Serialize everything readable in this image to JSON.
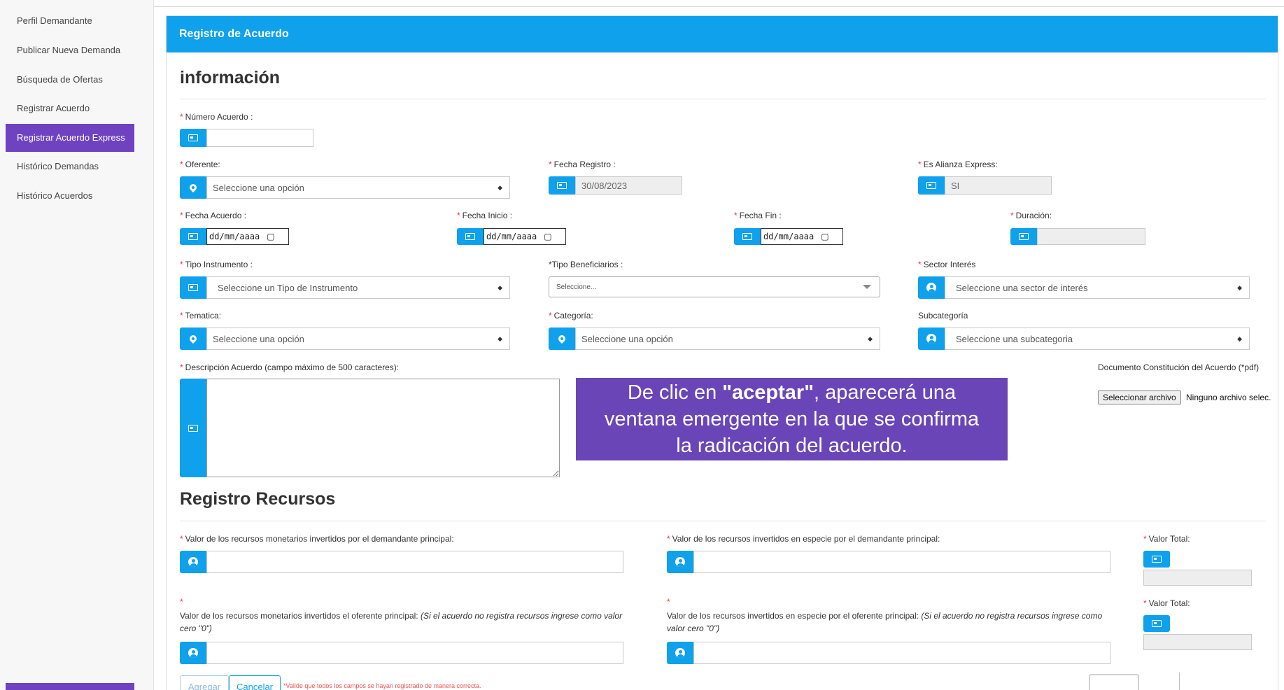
{
  "sidebar": {
    "items": [
      {
        "label": "Perfil Demandante"
      },
      {
        "label": "Publicar Nueva Demanda"
      },
      {
        "label": "Búsqueda de Ofertas"
      },
      {
        "label": "Registrar Acuerdo"
      },
      {
        "label": "Registrar Acuerdo Express",
        "active": true
      },
      {
        "label": "Histórico Demandas"
      },
      {
        "label": "Histórico Acuerdos"
      }
    ]
  },
  "panel": {
    "title": "Registro de Acuerdo",
    "section_info": "información",
    "section_resources": "Registro Recursos"
  },
  "form": {
    "numero_acuerdo": {
      "label": "Número Acuerdo :",
      "value": ""
    },
    "oferente": {
      "label": "Oferente:",
      "value": "Seleccione una opción"
    },
    "fecha_registro": {
      "label": "Fecha Registro :",
      "value": "30/08/2023"
    },
    "es_alianza": {
      "label": "Es Alianza Express:",
      "value": "SI"
    },
    "fecha_acuerdo": {
      "label": "Fecha Acuerdo :",
      "value": "dd/mm/aaaa"
    },
    "fecha_inicio": {
      "label": "Fecha Inicio :",
      "value": "dd/mm/aaaa"
    },
    "fecha_fin": {
      "label": "Fecha Fin :",
      "value": "dd/mm/aaaa"
    },
    "duracion": {
      "label": "Duración:",
      "value": ""
    },
    "tipo_instrumento": {
      "label": "Tipo Instrumento :",
      "value": "Seleccione un Tipo de Instrumento"
    },
    "tipo_beneficiarios": {
      "label": "*Tipo Beneficiarios :",
      "value": "Seleccione..."
    },
    "sector_interes": {
      "label": "Sector Interés",
      "value": "Seleccione una sector de interés"
    },
    "tematica": {
      "label": "Tematica:",
      "value": "Seleccione una opción"
    },
    "categoria": {
      "label": "Categoría:",
      "value": "Seleccione una opción"
    },
    "subcategoria": {
      "label": "Subcategoría",
      "value": "Seleccione una subcategoria"
    },
    "descripcion": {
      "label": "Descripción Acuerdo (campo máximo de 500 caracteres):",
      "value": ""
    },
    "documento": {
      "label": "Documento Constitución del Acuerdo (*pdf)",
      "button": "Seleccionar archivo",
      "status": "Ninguno archivo selec."
    }
  },
  "callout": {
    "line1_pre": "De clic en ",
    "line1_bold": "\"aceptar\"",
    "line1_post": ", aparecerá una",
    "line2": "ventana emergente en la que se confirma",
    "line3": "la radicación del acuerdo."
  },
  "resources": {
    "monetarios_demandante": {
      "label": "Valor de los recursos monetarios invertidos por el demandante principal:",
      "value": ""
    },
    "especie_demandante": {
      "label": "Valor de los recursos invertidos en especie por el demandante principal:",
      "value": ""
    },
    "valor_total_1": {
      "label": "Valor Total:",
      "value": ""
    },
    "monetarios_oferente": {
      "label": "Valor de los recursos monetarios invertidos el oferente principal:",
      "hint": "(Si el acuerdo no registra recursos ingrese como valor cero \"0\")",
      "value": ""
    },
    "especie_oferente": {
      "label": "Valor de los recursos invertidos en especie por el oferente principal:",
      "hint": "(Si el acuerdo no registra recursos ingrese como valor cero \"0\")",
      "value": ""
    },
    "valor_total_2": {
      "label": "Valor Total:",
      "value": ""
    }
  },
  "actions": {
    "agregar": "Agregar",
    "cancelar": "Cancelar",
    "validation": "*Valide que todos los campos se hayan registrado de manera correcta."
  },
  "required_mark": "*",
  "colors": {
    "accent": "#0fa1ec",
    "sidebar_active": "#6f42c1",
    "callout": "#6a45b8",
    "required": "#e53935"
  },
  "icons": [
    "id-card-icon",
    "map-pin-icon",
    "user-circle-icon",
    "calendar-icon",
    "select-caret-icon"
  ]
}
